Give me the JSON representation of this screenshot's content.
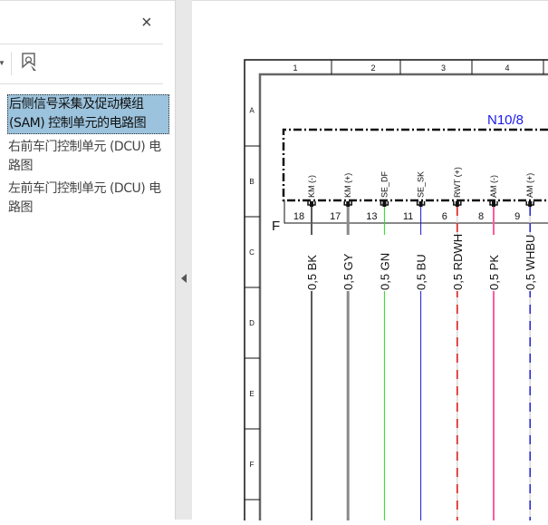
{
  "panel": {
    "close_icon": "×",
    "items": [
      {
        "label": "后侧信号采集及促动模组 (SAM) 控制单元的电路图",
        "selected": true
      },
      {
        "label": "右前车门控制单元 (DCU) 电路图",
        "selected": false
      },
      {
        "label": "左前车门控制单元 (DCU) 电路图",
        "selected": false
      }
    ]
  },
  "diagram": {
    "columns": [
      "1",
      "2",
      "3",
      "4"
    ],
    "rows": [
      "A",
      "B",
      "C",
      "D",
      "E",
      "F"
    ],
    "module": "N10/8",
    "connector": "F",
    "pins": [
      {
        "name": "KM (-)",
        "num": "18",
        "wire": "0,5 BK",
        "color": "#5a5a5a",
        "color2": null,
        "width": 2
      },
      {
        "name": "KM (+)",
        "num": "17",
        "wire": "0,5 GY",
        "color": "#8a8a8a",
        "color2": null,
        "width": 3
      },
      {
        "name": "SE_DF",
        "num": "13",
        "wire": "0,5 GN",
        "color": "#22dd22",
        "color2": null,
        "width": 1
      },
      {
        "name": "SE_SK",
        "num": "11",
        "wire": "0,5 BU",
        "color": "#1a1acc",
        "color2": null,
        "width": 1
      },
      {
        "name": "RWT (+)",
        "num": "6",
        "wire": "0,5 RDWH",
        "color": "#dd1111",
        "color2": "#d8d8d8",
        "width": 1.5
      },
      {
        "name": "AM (-)",
        "num": "8",
        "wire": "0,5 PK",
        "color": "#ff5c9c",
        "color2": null,
        "width": 2
      },
      {
        "name": "AM (+)",
        "num": "9",
        "wire": "0,5 WHBU",
        "color": "#2222cc",
        "color2": "#d8d8d8",
        "width": 1.5
      }
    ]
  }
}
